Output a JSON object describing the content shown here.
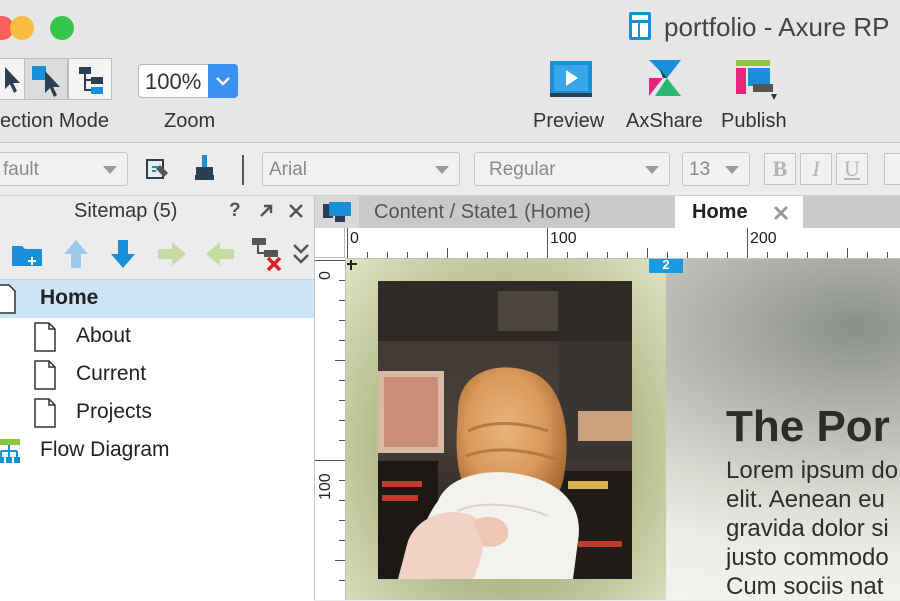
{
  "window": {
    "title": "portfolio - Axure RP",
    "traffic_colors": {
      "close": "#fc605c",
      "minimize": "#fdbc40",
      "maximize": "#34c84a"
    }
  },
  "toolbar": {
    "selection_mode_label": "ection Mode",
    "zoom_label": "Zoom",
    "zoom_value": "100%",
    "preview_label": "Preview",
    "axshare_label": "AxShare",
    "publish_label": "Publish"
  },
  "format_bar": {
    "style_value": "fault",
    "font_family_value": "Arial",
    "font_weight_value": "Regular",
    "font_size_value": "13",
    "bold_label": "B",
    "italic_label": "I",
    "underline_label": "U"
  },
  "sitemap": {
    "title": "Sitemap (5)",
    "help_label": "?",
    "items": [
      {
        "label": "Home",
        "selected": true
      },
      {
        "label": "About"
      },
      {
        "label": "Current"
      },
      {
        "label": "Projects"
      },
      {
        "label": "Flow Diagram"
      }
    ]
  },
  "editor": {
    "tabs": [
      {
        "label": "Content / State1 (Home)",
        "active": false
      },
      {
        "label": "Home",
        "active": true
      }
    ],
    "ruler_h": [
      "0",
      "100",
      "200"
    ],
    "ruler_v": [
      "0",
      "100"
    ],
    "marker_label": "2"
  },
  "canvas": {
    "hero_title": "The Por",
    "hero_lines": [
      "Lorem ipsum do",
      "elit. Aenean eu",
      "gravida dolor si",
      "justo commodo",
      "Cum sociis nat"
    ]
  },
  "colors": {
    "accent_blue": "#1a8fd9",
    "selection_bg": "#cce5f6",
    "axshare_magenta": "#e8257d",
    "publish_green": "#8cc63f"
  }
}
